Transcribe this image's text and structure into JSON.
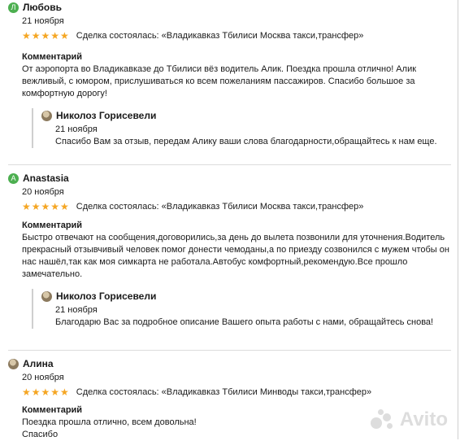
{
  "reviews": [
    {
      "author": "Любовь",
      "avatar_letter": "Л",
      "date": "21 ноября",
      "deal": "Сделка состоялась: «Владикавказ Тбилиси Москва такси,трансфер»",
      "comment_label": "Комментарий",
      "comment": "От аэропорта во Владикавказе до Тбилиси вёз водитель Алик. Поездка прошла отлично! Алик вежливый, с юмором, прислушиваться ко всем пожеланиям пассажиров. Спасибо большое за комфортную дорогу!",
      "reply": {
        "author": "Николоз Горисевели",
        "date": "21 ноября",
        "text": "Спасибо Вам за отзыв, передам Алику ваши слова благодарности,обращайтесь к нам еще."
      }
    },
    {
      "author": "Anastasia",
      "avatar_letter": "A",
      "date": "20 ноября",
      "deal": "Сделка состоялась: «Владикавказ Тбилиси Москва такси,трансфер»",
      "comment_label": "Комментарий",
      "comment": "Быстро отвечают на сообщения,договорились,за день до вылета позвонили для уточнения.Водитель прекрасный отзывчивый человек помог донести чемоданы,а по приезду созвонился с мужем чтобы он нас нашёл,так как моя симкарта не работала.Автобус комфортный,рекомендую.Все прошло замечательно.",
      "reply": {
        "author": "Николоз Горисевели",
        "date": "21 ноября",
        "text": "Благодарю Вас за подробное описание Вашего опыта работы с нами, обращайтесь снова!"
      }
    },
    {
      "author": "Алина",
      "date": "20 ноября",
      "deal": "Сделка состоялась: «Владикавказ Тбилиси Минводы такси,трансфер»",
      "comment_label": "Комментарий",
      "comment_line1": "Поездка прошла отлично, всем довольна!",
      "comment_line2": "Спасибо"
    }
  ],
  "stars": "★★★★★",
  "watermark": "Avito",
  "colors": {
    "stars": "#f5a623",
    "avatar_green": "#4caf50",
    "divider": "#dcdcdc"
  }
}
